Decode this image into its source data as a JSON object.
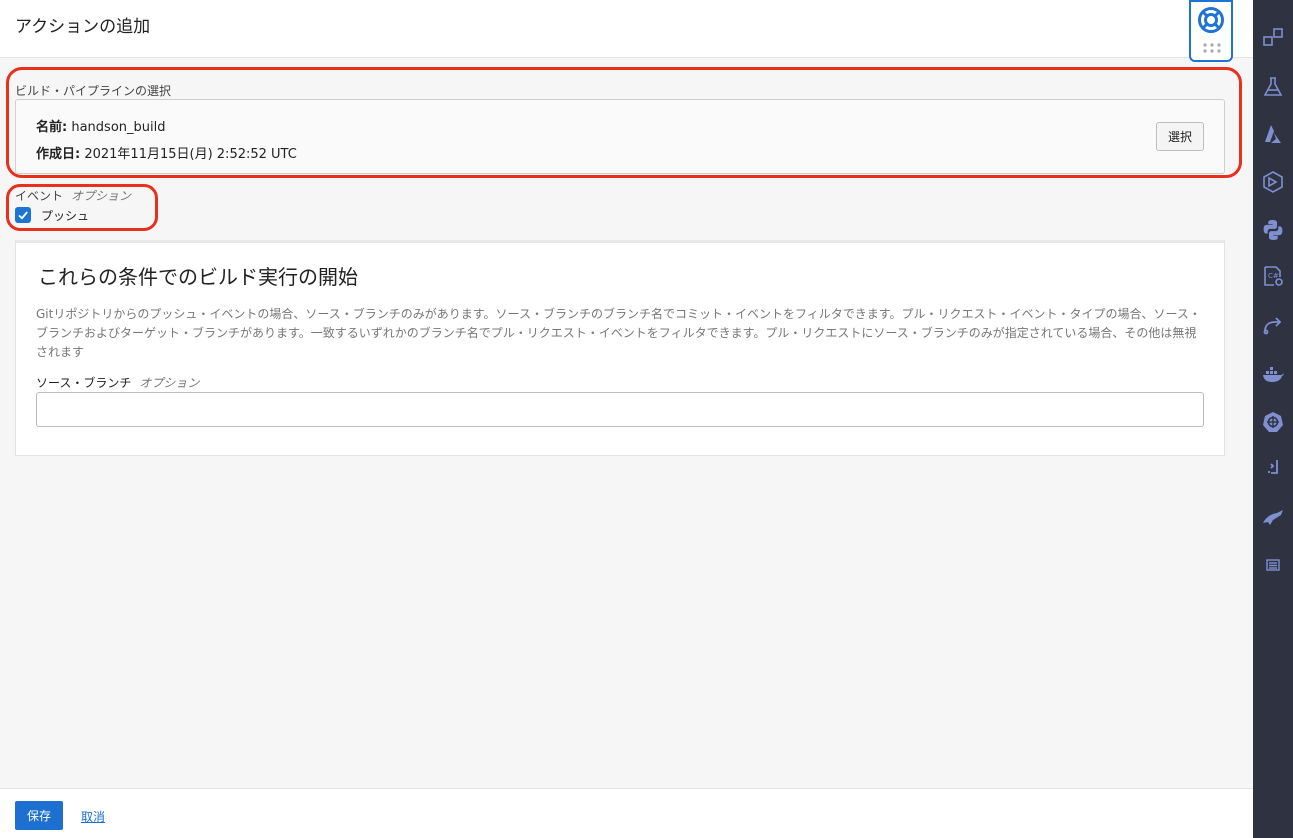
{
  "header": {
    "title": "アクションの追加"
  },
  "help": {
    "icon": "lifebuoy-icon"
  },
  "pipeline": {
    "section_label": "ビルド・パイプラインの選択",
    "name_label": "名前:",
    "name_value": "handson_build",
    "created_label": "作成日:",
    "created_value": "2021年11月15日(月) 2:52:52 UTC",
    "select_button": "選択"
  },
  "event": {
    "label": "イベント",
    "optional": "オプション",
    "checkbox_label": "プッシュ",
    "checked": true
  },
  "trigger": {
    "title": "これらの条件でのビルド実行の開始",
    "description": "Gitリポジトリからのプッシュ・イベントの場合、ソース・ブランチのみがあります。ソース・ブランチのブランチ名でコミット・イベントをフィルタできます。プル・リクエスト・イベント・タイプの場合、ソース・ブランチおよびターゲット・ブランチがあります。一致するいずれかのブランチ名でプル・リクエスト・イベントをフィルタできます。プル・リクエストにソース・ブランチのみが指定されている場合、その他は無視されます",
    "branch_label": "ソース・ブランチ",
    "branch_optional": "オプション",
    "branch_value": ""
  },
  "footer": {
    "save_label": "保存",
    "cancel_label": "取消"
  },
  "colors": {
    "accent": "#1d74d4",
    "highlight": "#e8301c",
    "rail": "#2f3241",
    "rail_icon": "#7f8fd0"
  },
  "rail": {
    "icons": [
      "apps-icon",
      "flask-icon",
      "azure-icon",
      "cube-icon",
      "python-icon",
      "settings-doc-icon",
      "share-icon",
      "docker-icon",
      "helm-icon",
      "terminal-icon",
      "jet-icon",
      "list-icon"
    ]
  }
}
